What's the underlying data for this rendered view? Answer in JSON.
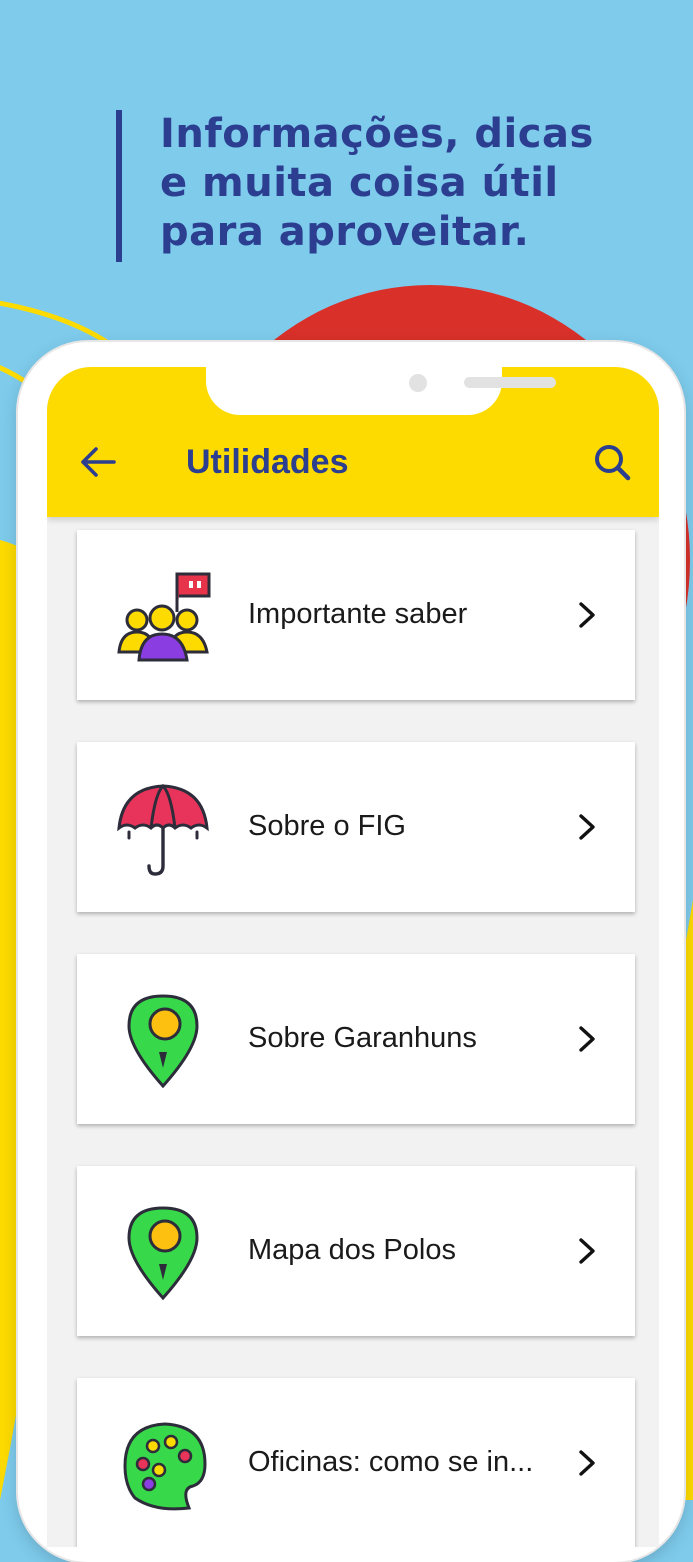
{
  "promo": {
    "headline_lines": [
      "Informações, dicas",
      "e muita coisa útil",
      "para aproveitar."
    ]
  },
  "header": {
    "title": "Utilidades",
    "back_icon": "arrow-left-icon",
    "search_icon": "search-icon"
  },
  "items": [
    {
      "label": "Importante saber",
      "icon": "group-with-flag-icon"
    },
    {
      "label": "Sobre o FIG",
      "icon": "umbrella-icon"
    },
    {
      "label": "Sobre Garanhuns",
      "icon": "map-pin-icon"
    },
    {
      "label": "Mapa dos Polos",
      "icon": "map-pin-icon"
    },
    {
      "label": "Oficinas: como se in...",
      "icon": "palette-icon"
    }
  ],
  "colors": {
    "background": "#7ecbec",
    "accent_yellow": "#fddb00",
    "brand_blue": "#2b3e8f",
    "red_blob": "#d9302a"
  }
}
